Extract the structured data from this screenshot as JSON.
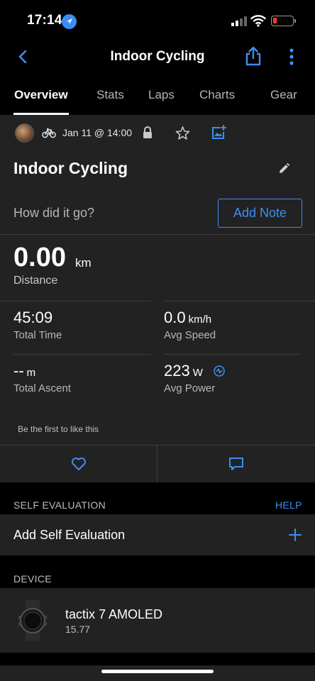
{
  "status": {
    "time": "17:14"
  },
  "nav": {
    "title": "Indoor Cycling"
  },
  "tabs": [
    "Overview",
    "Stats",
    "Laps",
    "Charts",
    "Gear"
  ],
  "activity": {
    "date": "Jan 11 @ 14:00",
    "title": "Indoor Cycling",
    "note_prompt": "How did it go?",
    "add_note_label": "Add Note"
  },
  "distance": {
    "value": "0.00",
    "unit": "km",
    "label": "Distance"
  },
  "stats": [
    {
      "value": "45:09",
      "unit": "",
      "label": "Total Time"
    },
    {
      "value": "0.0",
      "unit": "km/h",
      "label": "Avg Speed"
    },
    {
      "value": "--",
      "unit": "m",
      "label": "Total Ascent"
    },
    {
      "value": "223",
      "unit": "W",
      "label": "Avg Power"
    }
  ],
  "social": {
    "like_text": "Be the first to like this"
  },
  "self_evaluation": {
    "header": "SELF EVALUATION",
    "help": "HELP",
    "add_label": "Add Self Evaluation"
  },
  "device": {
    "header": "DEVICE",
    "name": "tactix 7 AMOLED",
    "version": "15.77"
  },
  "colors": {
    "accent": "#3b8ff0",
    "background": "#000000",
    "card": "#222222",
    "battery_low": "#ff3b30"
  },
  "icons": [
    "location-arrow-icon",
    "signal-icon",
    "wifi-icon",
    "battery-icon",
    "back-chevron-icon",
    "share-icon",
    "more-vertical-icon",
    "bike-icon",
    "lock-icon",
    "star-icon",
    "add-photo-icon",
    "edit-pencil-icon",
    "power-meter-icon",
    "heart-icon",
    "comment-icon",
    "plus-icon"
  ]
}
